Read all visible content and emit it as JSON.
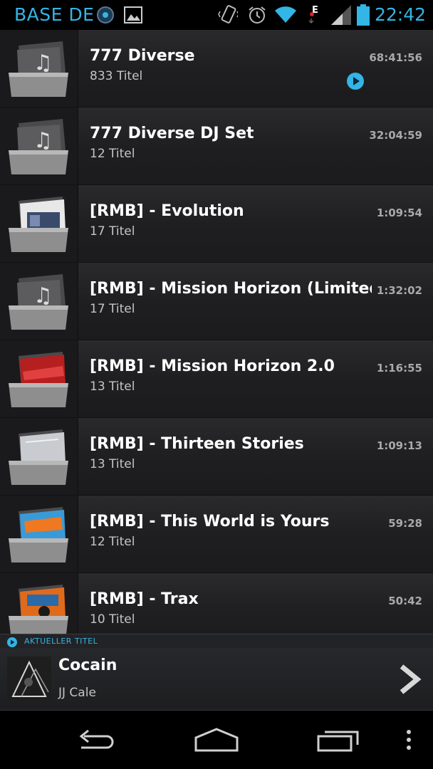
{
  "status_bar": {
    "carrier": "BASE DE",
    "time": "22:42",
    "accent_color": "#33b5e5",
    "icons": [
      "media-player-icon",
      "image-icon",
      "vibrate-icon",
      "alarm-icon",
      "wifi-icon",
      "data-e-icon",
      "signal-icon",
      "battery-icon"
    ]
  },
  "albums": [
    {
      "title": "777 Diverse",
      "count": "833 Titel",
      "duration": "68:41:56",
      "art": "folder-music-icon",
      "now_playing": true
    },
    {
      "title": "777 Diverse DJ Set",
      "count": "12 Titel",
      "duration": "32:04:59",
      "art": "folder-music-icon",
      "now_playing": false
    },
    {
      "title": "[RMB] - Evolution",
      "count": "17 Titel",
      "duration": "1:09:54",
      "art": "album-cover",
      "now_playing": false
    },
    {
      "title": "[RMB] - Mission Horizon (Limited Ed",
      "count": "17 Titel",
      "duration": "1:32:02",
      "art": "folder-music-icon",
      "now_playing": false
    },
    {
      "title": "[RMB] - Mission Horizon 2.0",
      "count": "13 Titel",
      "duration": "1:16:55",
      "art": "album-cover",
      "now_playing": false
    },
    {
      "title": "[RMB] - Thirteen Stories",
      "count": "13 Titel",
      "duration": "1:09:13",
      "art": "album-cover",
      "now_playing": false
    },
    {
      "title": "[RMB] - This World is Yours",
      "count": "12 Titel",
      "duration": "59:28",
      "art": "album-cover",
      "now_playing": false
    },
    {
      "title": "[RMB] - Trax",
      "count": "10 Titel",
      "duration": "50:42",
      "art": "album-cover",
      "now_playing": false
    }
  ],
  "now_playing": {
    "header": "AKTUELLER TITEL",
    "title": "Cocain",
    "artist": "JJ Cale"
  },
  "nav": [
    "back-icon",
    "home-icon",
    "recent-apps-icon",
    "overflow-menu-icon"
  ]
}
